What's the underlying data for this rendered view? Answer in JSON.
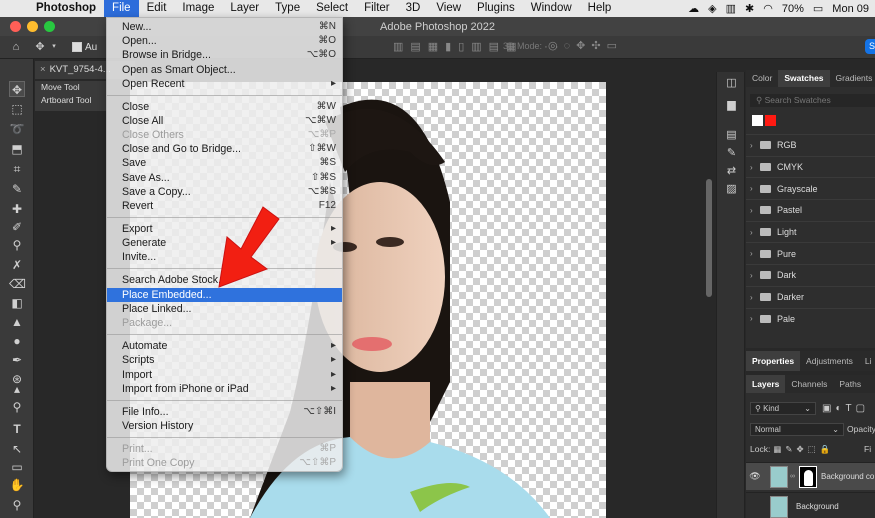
{
  "mac_menubar": {
    "app_name": "Photoshop",
    "items": [
      "File",
      "Edit",
      "Image",
      "Layer",
      "Type",
      "Select",
      "Filter",
      "3D",
      "View",
      "Plugins",
      "Window",
      "Help"
    ],
    "battery": "70%",
    "clock": "Mon 09"
  },
  "window": {
    "title": "Adobe Photoshop 2022"
  },
  "options_bar": {
    "auto_select_label": "Au",
    "three_d_mode_label": "3D Mode:"
  },
  "document": {
    "tab_title": "KVT_9754-4..."
  },
  "tool_presets": [
    "Move Tool",
    "Artboard Tool"
  ],
  "file_menu": {
    "items": [
      {
        "label": "New...",
        "shortcut": "⌘N",
        "state": "enabled"
      },
      {
        "label": "Open...",
        "shortcut": "⌘O",
        "state": "enabled"
      },
      {
        "label": "Browse in Bridge...",
        "shortcut": "⌥⌘O",
        "state": "enabled"
      },
      {
        "label": "Open as Smart Object...",
        "shortcut": "",
        "state": "enabled"
      },
      {
        "label": "Open Recent",
        "shortcut": "▸",
        "state": "enabled"
      },
      {
        "label": "Close",
        "shortcut": "⌘W",
        "state": "enabled"
      },
      {
        "label": "Close All",
        "shortcut": "⌥⌘W",
        "state": "enabled"
      },
      {
        "label": "Close Others",
        "shortcut": "⌥⌘P",
        "state": "disabled"
      },
      {
        "label": "Close and Go to Bridge...",
        "shortcut": "⇧⌘W",
        "state": "enabled"
      },
      {
        "label": "Save",
        "shortcut": "⌘S",
        "state": "enabled"
      },
      {
        "label": "Save As...",
        "shortcut": "⇧⌘S",
        "state": "enabled"
      },
      {
        "label": "Save a Copy...",
        "shortcut": "⌥⌘S",
        "state": "enabled"
      },
      {
        "label": "Revert",
        "shortcut": "F12",
        "state": "enabled"
      },
      {
        "label": "Export",
        "shortcut": "▸",
        "state": "enabled"
      },
      {
        "label": "Generate",
        "shortcut": "▸",
        "state": "enabled"
      },
      {
        "label": "Invite...",
        "shortcut": "",
        "state": "enabled"
      },
      {
        "label": "Search Adobe Stock...",
        "shortcut": "",
        "state": "enabled"
      },
      {
        "label": "Place Embedded...",
        "shortcut": "",
        "state": "highlighted"
      },
      {
        "label": "Place Linked...",
        "shortcut": "",
        "state": "enabled"
      },
      {
        "label": "Package...",
        "shortcut": "",
        "state": "disabled"
      },
      {
        "label": "Automate",
        "shortcut": "▸",
        "state": "enabled"
      },
      {
        "label": "Scripts",
        "shortcut": "▸",
        "state": "enabled"
      },
      {
        "label": "Import",
        "shortcut": "▸",
        "state": "enabled"
      },
      {
        "label": "Import from iPhone or iPad",
        "shortcut": "▸",
        "state": "enabled"
      },
      {
        "label": "File Info...",
        "shortcut": "⌥⇧⌘I",
        "state": "enabled"
      },
      {
        "label": "Version History",
        "shortcut": "",
        "state": "enabled"
      },
      {
        "label": "Print...",
        "shortcut": "⌘P",
        "state": "disabled"
      },
      {
        "label": "Print One Copy",
        "shortcut": "⌥⇧⌘P",
        "state": "disabled"
      }
    ]
  },
  "swatches_panel": {
    "tabs": [
      "Color",
      "Swatches",
      "Gradients"
    ],
    "active_tab": "Swatches",
    "search_placeholder": "Search Swatches",
    "recent_colors": [
      "#ffffff",
      "#ff1a12"
    ],
    "folders": [
      "RGB",
      "CMYK",
      "Grayscale",
      "Pastel",
      "Light",
      "Pure",
      "Dark",
      "Darker",
      "Pale"
    ]
  },
  "properties_panel": {
    "tabs": [
      "Properties",
      "Adjustments",
      "Li"
    ]
  },
  "layers_panel": {
    "tabs": [
      "Layers",
      "Channels",
      "Paths"
    ],
    "filter_kind": "Kind",
    "blend_mode": "Normal",
    "opacity_label": "Opacity",
    "lock_label": "Lock:",
    "fill_label": "Fi",
    "layers": [
      {
        "name": "Background co",
        "selected": true
      },
      {
        "name": "Background",
        "selected": false
      }
    ]
  }
}
